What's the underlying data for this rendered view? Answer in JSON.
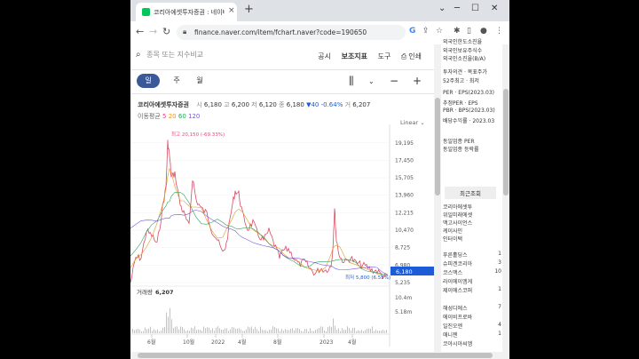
{
  "tab": {
    "title": "코리아에셋투자증권 : 네이버 금",
    "close": "×",
    "new": "+"
  },
  "window": {
    "min": "─",
    "max": "☐",
    "close": "✕",
    "menu": "⌄"
  },
  "address": {
    "url": "finance.naver.com/item/fchart.naver?code=190650"
  },
  "search": {
    "placeholder": "종목 또는 지수비교"
  },
  "toplinks": {
    "notice": "공시",
    "indicator": "보조지표",
    "tools": "도구",
    "print": "인쇄"
  },
  "periods": {
    "day": "일",
    "week": "주",
    "month": "월"
  },
  "quote": {
    "name": "코리아에셋투자증권",
    "open_lbl": "시",
    "open": "6,180",
    "high_lbl": "고",
    "high": "6,200",
    "low_lbl": "저",
    "low": "6,120",
    "close_lbl": "종",
    "close": "6,180",
    "change": "▼40 -0.64%",
    "vol_lbl": "거",
    "vol": "6,207"
  },
  "ma": {
    "label": "이동평균",
    "m5": "5",
    "m20": "20",
    "m60": "60",
    "m120": "120"
  },
  "scale": "Linear",
  "chart_data": {
    "type": "line",
    "price_axis": [
      "19,195",
      "17,450",
      "15,705",
      "13,960",
      "12,215",
      "10,470",
      "8,725",
      "6,980",
      "6,180",
      "5,235"
    ],
    "volume_axis": [
      "10.4m",
      "5.18m"
    ],
    "x_ticks": [
      "6월",
      "10월",
      "2022",
      "4월",
      "8월",
      "2023",
      "4월"
    ],
    "max_label": "최고 20,150 (-69.33%)",
    "min_label": "최저 5,800 (6.55%)",
    "volume_label": "거래량",
    "volume_value": "6,207",
    "current": "6,180",
    "ylim": [
      5235,
      20150
    ]
  },
  "side": {
    "items": [
      "외국인한도소진율",
      "외국인보유주식수",
      "외국인소진율(B/A)",
      "투자의견 · 목표주가",
      "52주최고 · 최저",
      "PER · EPS(2023.03)",
      "추정PER · EPS",
      "PBR · BPS(2023.03)",
      "배당수익률 · 2023.03",
      "동일업종 PER",
      "동일업종 등락률"
    ],
    "recent_title": "최근조회",
    "recent": [
      "코리아에셋투",
      "위일미래에셋",
      "맥고사이언스",
      "케이사인",
      "인터이택"
    ],
    "rows": [
      {
        "name": "푸른홀딩스",
        "n": "1"
      },
      {
        "name": "슈피겐코리아",
        "n": "3"
      },
      {
        "name": "코스맥스",
        "n": "10"
      },
      {
        "name": "라이에이엠게",
        "n": ""
      },
      {
        "name": "제이에스코퍼",
        "n": "1"
      },
      {
        "name": "해성디에스",
        "n": "7"
      },
      {
        "name": "에이비프로바",
        "n": ""
      },
      {
        "name": "일진오엔",
        "n": "4"
      },
      {
        "name": "애니젠",
        "n": "1"
      },
      {
        "name": "코아시아씨엠",
        "n": ""
      }
    ]
  }
}
